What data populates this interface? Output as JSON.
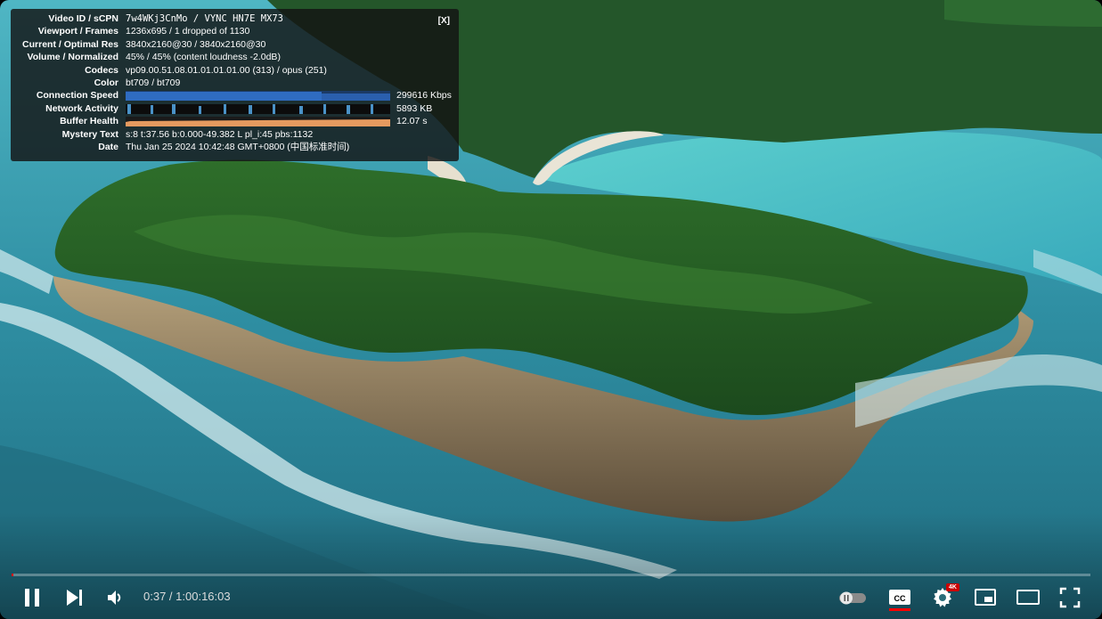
{
  "stats_panel": {
    "close_label": "[X]",
    "rows": {
      "video_id": {
        "label": "Video ID / sCPN",
        "value": "7w4WKj3CnMo  /  VYNC HN7E MX73"
      },
      "viewport": {
        "label": "Viewport / Frames",
        "value": "1236x695 / 1 dropped of 1130"
      },
      "resolution": {
        "label": "Current / Optimal Res",
        "value": "3840x2160@30 / 3840x2160@30"
      },
      "volume": {
        "label": "Volume / Normalized",
        "value": "45% / 45% (content loudness -2.0dB)"
      },
      "codecs": {
        "label": "Codecs",
        "value": "vp09.00.51.08.01.01.01.01.00 (313) / opus (251)"
      },
      "color": {
        "label": "Color",
        "value": "bt709 / bt709"
      },
      "connection_speed": {
        "label": "Connection Speed",
        "value": "299616 Kbps"
      },
      "network_activity": {
        "label": "Network Activity",
        "value": "5893 KB"
      },
      "buffer_health": {
        "label": "Buffer Health",
        "value": "12.07 s"
      },
      "mystery_text": {
        "label": "Mystery Text",
        "value": "s:8 t:37.56 b:0.000-49.382 L pl_i:45 pbs:1132"
      },
      "date": {
        "label": "Date",
        "value": "Thu Jan 25 2024 10:42:48 GMT+0800 (中国标准时间)"
      }
    }
  },
  "player": {
    "current_time": "0:37",
    "separator": " / ",
    "duration": "1:00:16:03",
    "progress": 0.0002,
    "quality_badge": "4K",
    "accent_color": "#ff0000"
  }
}
